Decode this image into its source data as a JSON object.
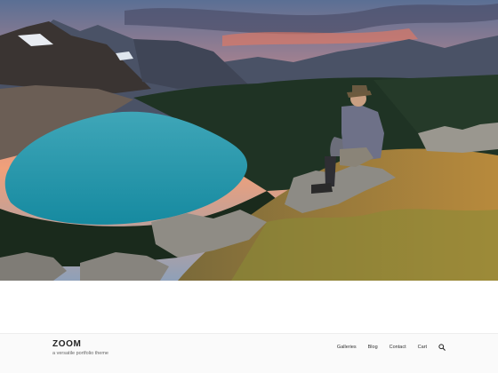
{
  "site": {
    "title": "ZOOM",
    "description": "a versatile portfolio theme"
  },
  "nav": {
    "items": [
      {
        "label": "Galleries"
      },
      {
        "label": "Blog"
      },
      {
        "label": "Contact"
      },
      {
        "label": "Cart"
      }
    ],
    "search_icon": "search-icon"
  },
  "hero": {
    "image": "mountain-lake-hiker-photo"
  },
  "colors": {
    "header_bg": "#fafafa",
    "text": "#222222",
    "tagline": "#666666"
  }
}
